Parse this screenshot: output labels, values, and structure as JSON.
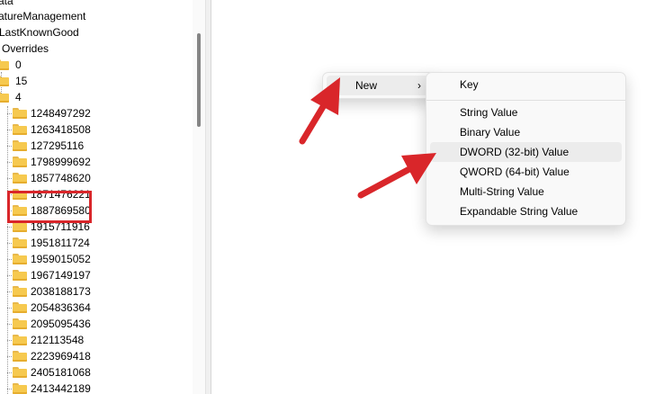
{
  "tree": {
    "partial_rows": [
      "ata",
      "atureManagement",
      "LastKnownGood",
      "Overrides"
    ],
    "level1": [
      "0",
      "15",
      "4"
    ],
    "keys": [
      "1248497292",
      "1263418508",
      "127295116",
      "1798999692",
      "1857748620",
      "1871476221",
      "1887869580",
      "1915711916",
      "1951811724",
      "1959015052",
      "1967149197",
      "2038188173",
      "2054836364",
      "2095095436",
      "212113548",
      "2223969418",
      "2405181068",
      "2413442189"
    ]
  },
  "context_menu": {
    "new_label": "New",
    "new_arrow": "›"
  },
  "submenu": {
    "items": [
      "Key",
      "String Value",
      "Binary Value",
      "DWORD (32-bit) Value",
      "QWORD (64-bit) Value",
      "Multi-String Value",
      "Expandable String Value"
    ],
    "highlighted": "DWORD (32-bit) Value"
  },
  "icons": [
    "folder-icon",
    "chevron-right-icon"
  ],
  "colors": {
    "annotation_red": "#d9262a",
    "folder_yellow": "#f6c94f",
    "menu_background": "#f9f9f9",
    "hover_background": "#ececec"
  }
}
